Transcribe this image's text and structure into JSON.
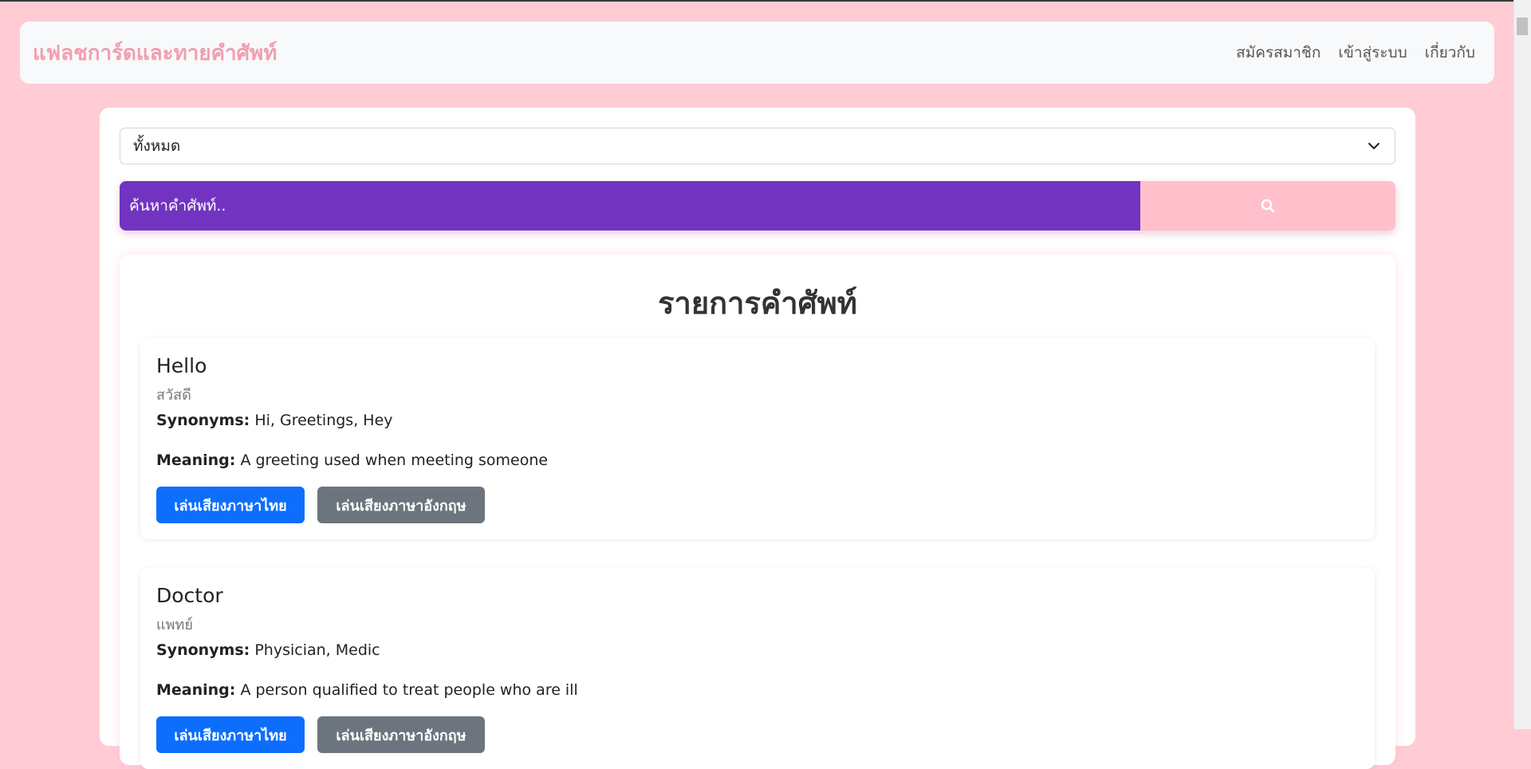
{
  "navbar": {
    "brand": "แฟลชการ์ดและทายคำศัพท์",
    "links": [
      "สมัครสมาชิก",
      "เข้าสู่ระบบ",
      "เกี่ยวกับ"
    ]
  },
  "filter": {
    "selected": "ทั้งหมด",
    "icon": "chevron-down-icon"
  },
  "search": {
    "placeholder": "ค้นหาคำศัพท์..",
    "button_icon": "search-icon"
  },
  "list": {
    "title": "รายการคำศัพท์",
    "words": [
      {
        "word": "Hello",
        "thai": "สวัสดี",
        "synonyms_label": "Synonyms",
        "synonyms": "Hi, Greetings, Hey",
        "meaning_label": "Meaning",
        "meaning": "A greeting used when meeting someone",
        "play_thai": "เล่นเสียงภาษาไทย",
        "play_english": "เล่นเสียงภาษาอังกฤษ"
      },
      {
        "word": "Doctor",
        "thai": "แพทย์",
        "synonyms_label": "Synonyms",
        "synonyms": "Physician, Medic",
        "meaning_label": "Meaning",
        "meaning": "A person qualified to treat people who are ill",
        "play_thai": "เล่นเสียงภาษาไทย",
        "play_english": "เล่นเสียงภาษาอังกฤษ"
      }
    ]
  },
  "colors": {
    "page_background": "#ffccd5",
    "brand": "#f29fb0",
    "search_bar": "#7234c0",
    "search_button": "#ffbfcb",
    "primary_button": "#0d6efd",
    "secondary_button": "#6c757d"
  }
}
